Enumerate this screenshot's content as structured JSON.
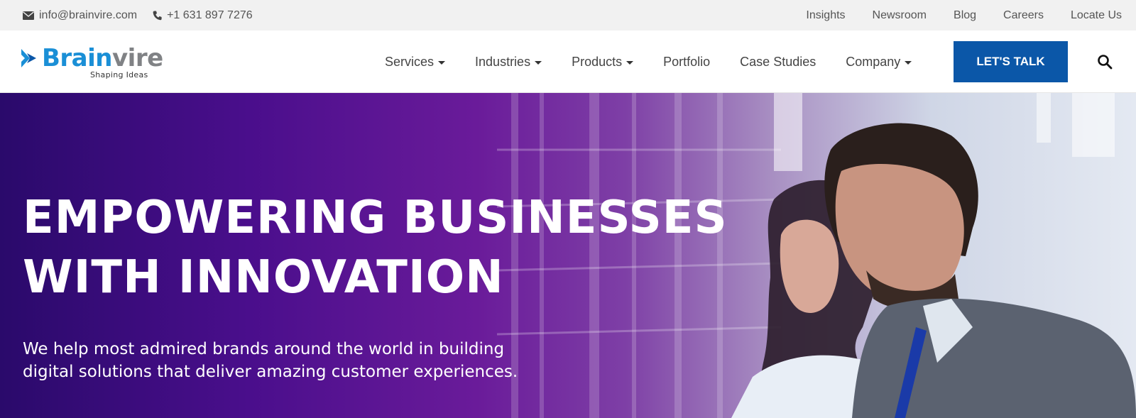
{
  "topbar": {
    "email": "info@brainvire.com",
    "phone": "+1 631 897 7276",
    "links": [
      "Insights",
      "Newsroom",
      "Blog",
      "Careers",
      "Locate Us"
    ],
    "email_icon": "envelope-icon",
    "phone_icon": "phone-icon"
  },
  "header": {
    "logo": {
      "word_part1": "Brain",
      "word_part2": "vire",
      "tagline": "Shaping Ideas"
    },
    "nav": [
      {
        "label": "Services",
        "dropdown": true
      },
      {
        "label": "Industries",
        "dropdown": true
      },
      {
        "label": "Products",
        "dropdown": true
      },
      {
        "label": "Portfolio",
        "dropdown": false
      },
      {
        "label": "Case Studies",
        "dropdown": false
      },
      {
        "label": "Company",
        "dropdown": true
      }
    ],
    "cta_label": "LET'S TALK",
    "search_icon": "search-icon"
  },
  "hero": {
    "title_line1": "EMPOWERING BUSINESSES",
    "title_line2": "WITH INNOVATION",
    "subtitle_line1": "We help most admired brands around the world in building",
    "subtitle_line2": "digital solutions that deliver amazing customer experiences."
  },
  "colors": {
    "brand_blue": "#1a8fd6",
    "brand_gray": "#808285",
    "cta_blue": "#0b57a8",
    "hero_purple": "#4a0e8c"
  }
}
